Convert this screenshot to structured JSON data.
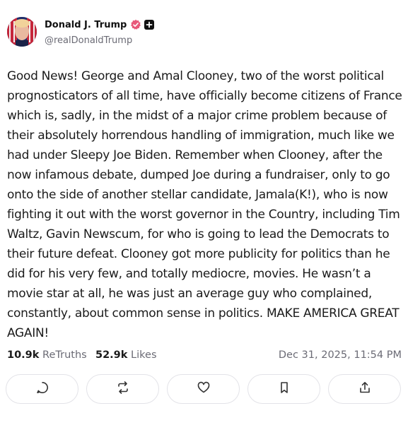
{
  "author": {
    "display_name": "Donald J. Trump",
    "handle": "@realDonaldTrump"
  },
  "post": {
    "text": "Good News! George and Amal Clooney, two of the worst political prognosticators of all time, have officially become citizens of France which is, sadly, in the midst of a major crime problem because of their absolutely horrendous handling of immigration, much like we had under Sleepy Joe Biden. Remember when Clooney, after the now infamous debate, dumped Joe during a fundraiser, only to go onto the side of another stellar candidate, Jamala(K!), who is now fighting it out with the worst governor in the Country, including Tim Waltz, Gavin Newscum, for who is going to lead the Democrats to their future defeat. Clooney got more publicity for politics than he did for his very few, and totally mediocre, movies. He wasn’t a movie star at all, he was just an average guy who complained, constantly, about common sense in politics. MAKE AMERICA GREAT AGAIN!"
  },
  "stats": {
    "retruths_count": "10.9k",
    "retruths_label": "ReTruths",
    "likes_count": "52.9k",
    "likes_label": "Likes",
    "timestamp": "Dec 31, 2025, 11:54 PM"
  },
  "actions": [
    {
      "icon": "reply-icon"
    },
    {
      "icon": "retruth-icon"
    },
    {
      "icon": "like-icon"
    },
    {
      "icon": "bookmark-icon"
    },
    {
      "icon": "share-icon"
    }
  ],
  "colors": {
    "verified_badge": "#e8587a",
    "muted_text": "#6b6b75",
    "button_border": "#e3e3e8"
  }
}
